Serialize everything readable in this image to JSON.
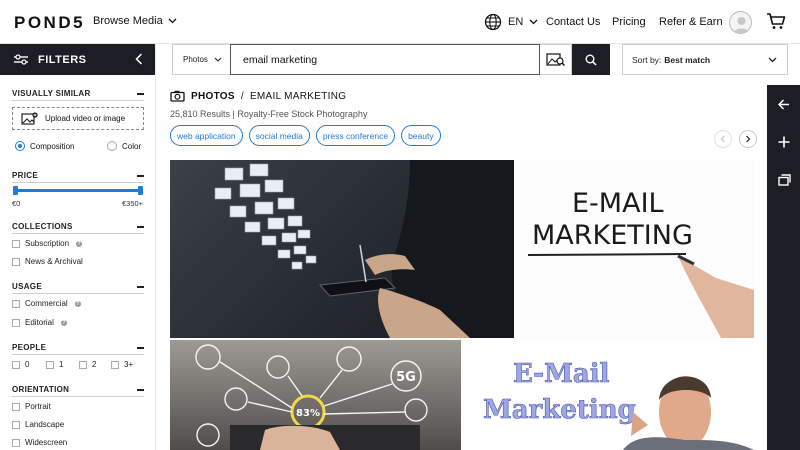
{
  "header": {
    "logo": "POND5",
    "browse_label": "Browse Media",
    "lang_label": "EN",
    "links": {
      "contact": "Contact Us",
      "pricing": "Pricing",
      "refer": "Refer & Earn"
    }
  },
  "sidebar": {
    "title": "FILTERS",
    "visually_similar": {
      "title": "VISUALLY SIMILAR",
      "upload_label": "Upload video or image",
      "option_composition": "Composition",
      "option_color": "Color",
      "selected": "Composition"
    },
    "price": {
      "title": "PRICE",
      "min_label": "€0",
      "max_label": "€350+"
    },
    "collections": {
      "title": "COLLECTIONS",
      "items": [
        "Subscription",
        "News & Archival"
      ]
    },
    "usage": {
      "title": "USAGE",
      "items": [
        "Commercial",
        "Editorial"
      ]
    },
    "people": {
      "title": "PEOPLE",
      "items": [
        "0",
        "1",
        "2",
        "3+"
      ]
    },
    "orientation": {
      "title": "ORIENTATION",
      "items": [
        "Portrait",
        "Landscape",
        "Widescreen"
      ]
    }
  },
  "search": {
    "media_type": "Photos",
    "query": "email marketing",
    "sort_prefix": "Sort by:",
    "sort_value": "Best match"
  },
  "results": {
    "breadcrumb_type": "PHOTOS",
    "breadcrumb_sep": "/",
    "breadcrumb_query": "EMAIL MARKETING",
    "summary": "25,810 Results | Royalty-Free Stock Photography",
    "chips": [
      "web application",
      "social media",
      "press conference",
      "beauty"
    ]
  },
  "images": {
    "img2_line1": "E-MAIL",
    "img2_line2": "MARKETING",
    "img3_badge": "83%",
    "img3_label": "5G",
    "img4_line1": "E-Mail",
    "img4_line2": "Marketing"
  },
  "colors": {
    "accent": "#1e7bd6",
    "dark": "#1d1d25"
  },
  "icons": {
    "globe": "globe-icon",
    "cart": "cart-icon",
    "user": "user-icon",
    "filters": "sliders-icon",
    "camera": "camera-icon",
    "search": "search-icon",
    "visual_search": "image-search-icon",
    "rail": [
      "arrow-left-icon",
      "plus-icon",
      "collection-icon"
    ]
  }
}
